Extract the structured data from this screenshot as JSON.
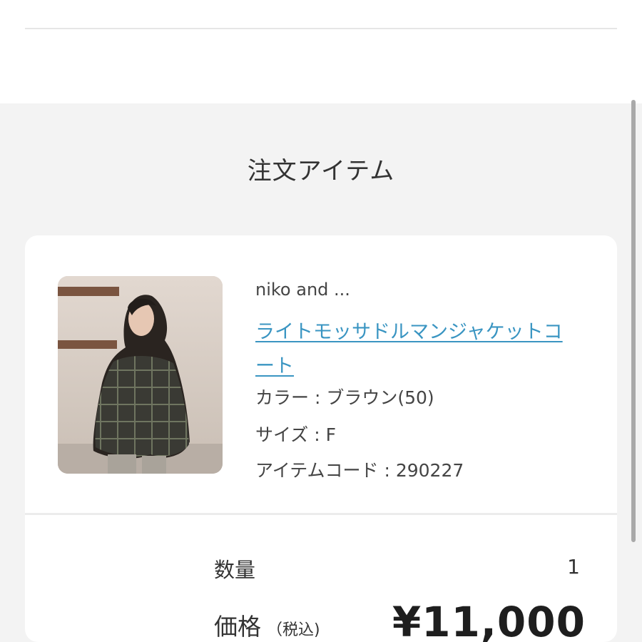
{
  "section": {
    "title": "注文アイテム"
  },
  "item": {
    "image_alt": "product photo",
    "brand": "niko and ...",
    "name": "ライトモッサドルマンジャケットコート",
    "color": "カラー : ブラウン(50)",
    "size": "サイズ : F",
    "code": "アイテムコード : 290227"
  },
  "summary": {
    "quantity_label": "数量",
    "quantity_value": "1",
    "price_label": "価格",
    "price_note": "（税込)",
    "price_value": "¥11,000"
  },
  "colors": {
    "link": "#3a95c2",
    "background": "#f3f3f3",
    "card": "#ffffff"
  }
}
